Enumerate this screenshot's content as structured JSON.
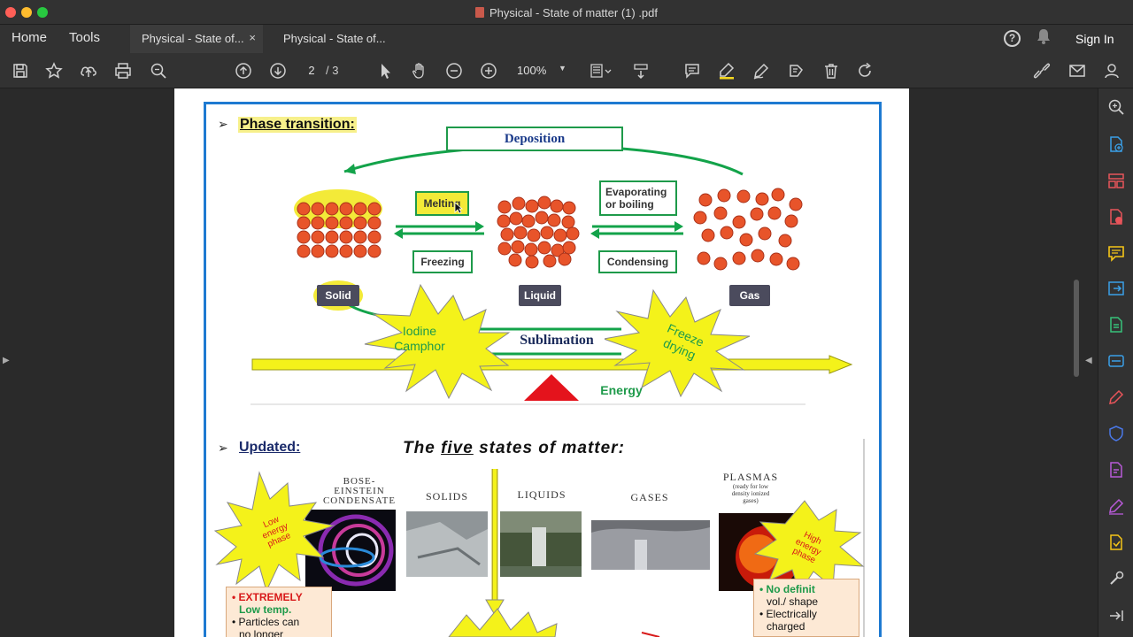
{
  "window": {
    "title": "Physical - State of matter (1) .pdf"
  },
  "menu": {
    "home": "Home",
    "tools": "Tools",
    "sign_in": "Sign In"
  },
  "tabs": [
    {
      "label": "Physical - State of...",
      "close": "×"
    },
    {
      "label": "Physical - State of..."
    }
  ],
  "toolbar": {
    "page_current": "2",
    "page_total": "/ 3",
    "zoom": "100%"
  },
  "document": {
    "section1": "Phase transition:",
    "deposition": "Deposition",
    "melting": "Melting",
    "freezing": "Freezing",
    "evaporating": [
      "Evaporating",
      "or boiling"
    ],
    "condensing": "Condensing",
    "solid": "Solid",
    "liquid": "Liquid",
    "gas": "Gas",
    "iodine": [
      "Iodine",
      "Camphor"
    ],
    "sublimation": "Sublimation",
    "freeze_drying": [
      "Freeze",
      "drying"
    ],
    "energy": "Energy",
    "section2": "Updated:",
    "five_title_pre": "The ",
    "five_title_em": "five",
    "five_title_post": " states of matter:",
    "cap_bec": [
      "BOSE-",
      "EINSTEIN",
      "CONDENSATE"
    ],
    "cap_solids": "SOLIDS",
    "cap_liquids": "LIQUIDS",
    "cap_gases": "GASES",
    "cap_plasmas": "PLASMAS",
    "cap_plasmas_sub": [
      "(ready for low",
      "density ionized",
      "gases)"
    ],
    "low_energy": [
      "Low",
      "energy",
      "phase"
    ],
    "high_energy": [
      "High",
      "energy",
      "phase"
    ],
    "note_left": [
      "• EXTREMELY",
      "Low temp.",
      "• Particles can",
      "no longer"
    ],
    "note_right": [
      "• No definit",
      "vol./ shape",
      "• Electrically",
      "charged"
    ]
  },
  "colors": {
    "accent_blue": "#1e7ad1",
    "green": "#1e9a4a",
    "particle": "#e8542a",
    "yellow": "#f4f21a"
  }
}
